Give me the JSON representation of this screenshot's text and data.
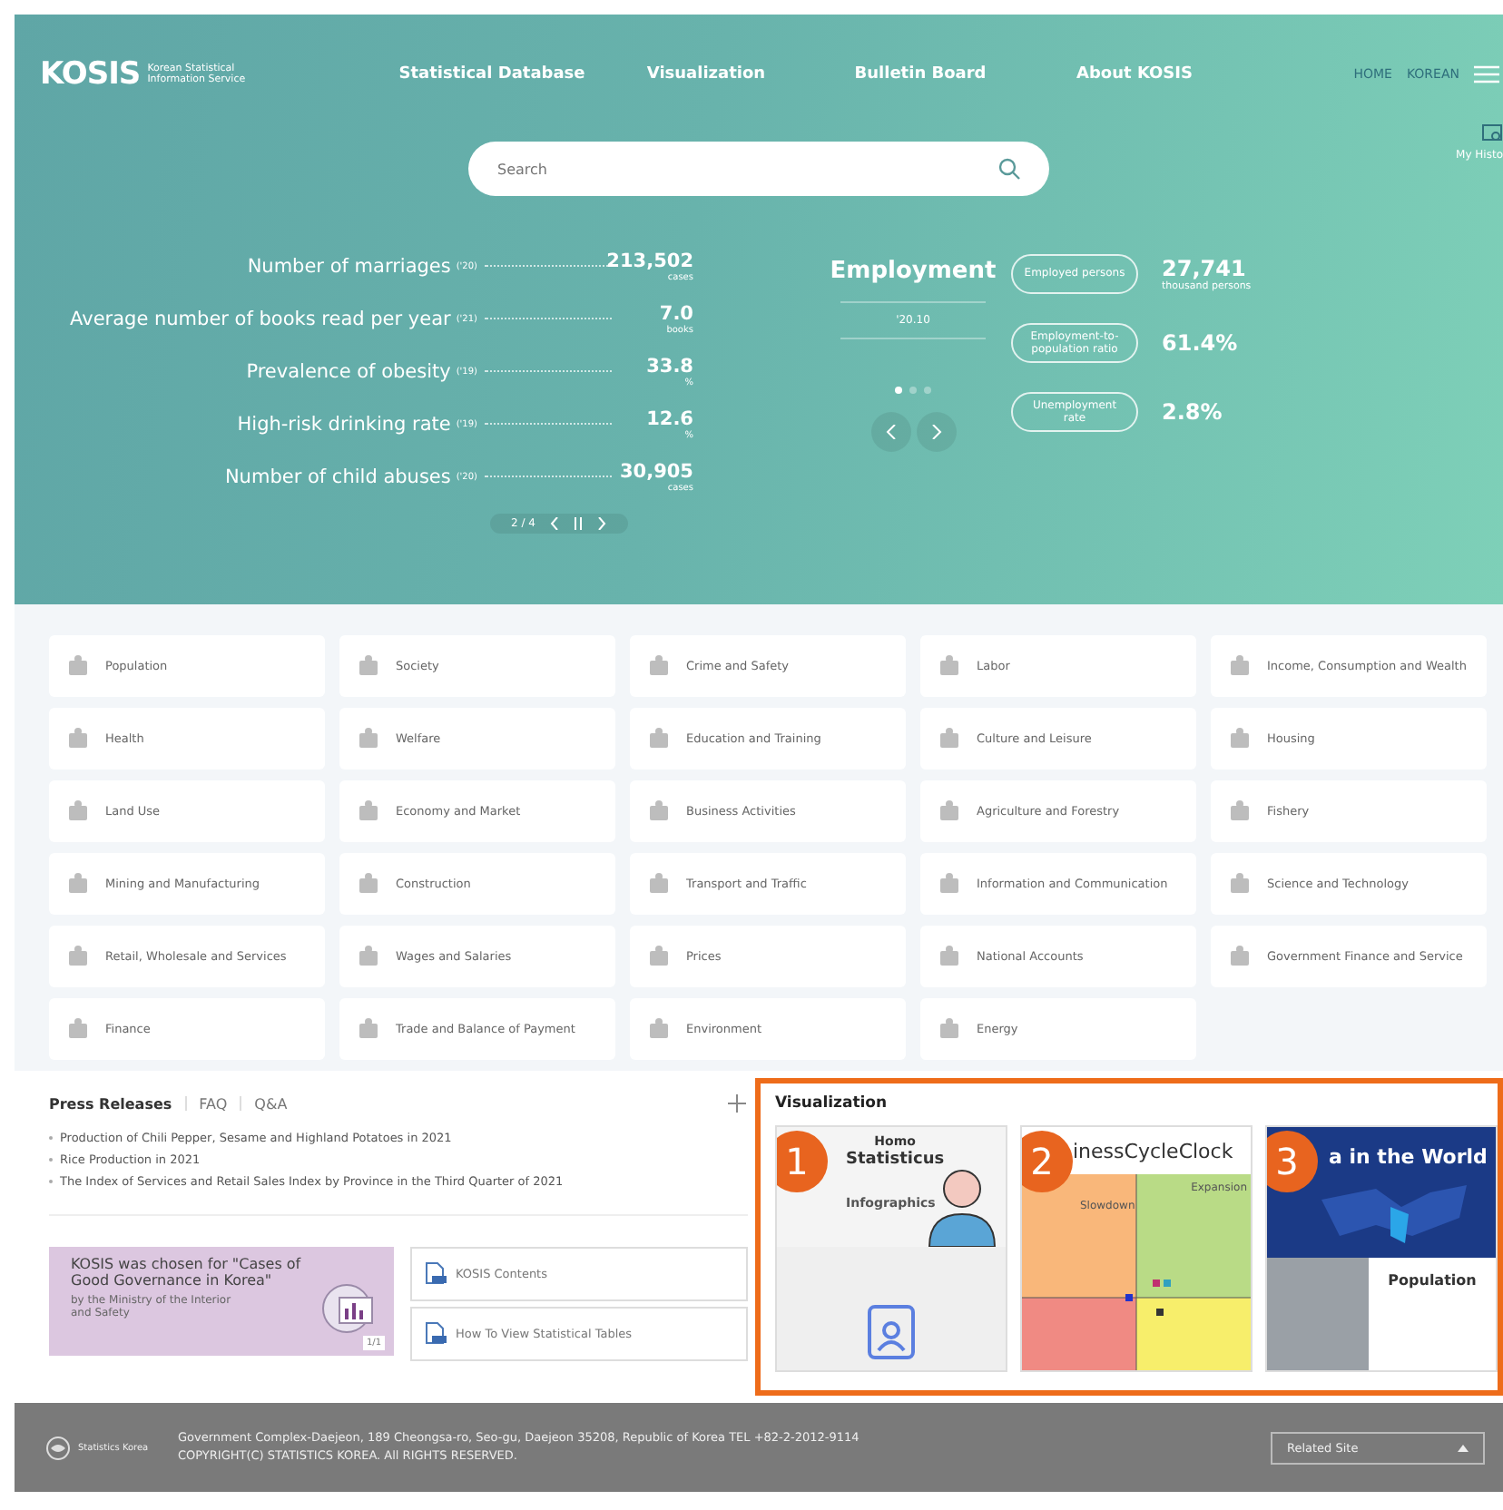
{
  "header": {
    "logo": "KOSIS",
    "logo_subtitle": "Korean Statistical Information Service",
    "nav": [
      "Statistical Database",
      "Visualization",
      "Bulletin Board",
      "About KOSIS"
    ],
    "utility_links": [
      "HOME",
      "KOREAN"
    ],
    "my_history": "My Histo"
  },
  "search": {
    "placeholder": "Search"
  },
  "indicators": [
    {
      "label": "Number of marriages",
      "year": "('20)",
      "value": "213,502",
      "unit": "cases"
    },
    {
      "label": "Average number of books read per year",
      "year": "('21)",
      "value": "7.0",
      "unit": "books"
    },
    {
      "label": "Prevalence of obesity",
      "year": "('19)",
      "value": "33.8",
      "unit": "%"
    },
    {
      "label": "High-risk drinking rate",
      "year": "('19)",
      "value": "12.6",
      "unit": "%"
    },
    {
      "label": "Number of child abuses",
      "year": "('20)",
      "value": "30,905",
      "unit": "cases"
    }
  ],
  "indicator_pager": "2 / 4",
  "employment": {
    "title": "Employment",
    "period": "'20.10",
    "dots": [
      {
        "selected": true
      },
      {
        "selected": false
      },
      {
        "selected": false
      }
    ],
    "rows": [
      {
        "label": "Employed persons",
        "value": "27,741",
        "unit": "thousand persons"
      },
      {
        "label": "Employment-to-population ratio",
        "value": "61.4%"
      },
      {
        "label": "Unemployment rate",
        "value": "2.8%"
      }
    ]
  },
  "categories": [
    "Population",
    "Society",
    "Crime and Safety",
    "Labor",
    "Income, Consumption and Wealth",
    "Health",
    "Welfare",
    "Education and Training",
    "Culture and Leisure",
    "Housing",
    "Land Use",
    "Economy and Market",
    "Business Activities",
    "Agriculture and Forestry",
    "Fishery",
    "Mining and Manufacturing",
    "Construction",
    "Transport and Traffic",
    "Information and Communication",
    "Science and Technology",
    "Retail, Wholesale and Services",
    "Wages and Salaries",
    "Prices",
    "National Accounts",
    "Government Finance and Service",
    "Finance",
    "Trade and Balance of Payment",
    "Environment",
    "Energy"
  ],
  "board": {
    "tabs": [
      {
        "label": "Press Releases",
        "selected": true
      },
      {
        "label": "FAQ",
        "selected": false
      },
      {
        "label": "Q&A",
        "selected": false
      }
    ],
    "items": [
      "Production of Chili Pepper, Sesame and Highland Potatoes in 2021",
      "Rice Production in 2021",
      "The Index of Services and Retail Sales Index by Province in the Third Quarter of 2021"
    ]
  },
  "banner": {
    "title": "KOSIS was chosen for \"Cases of Good Governance in Korea\"",
    "subtitle": "by the Ministry of the Interior and Safety",
    "pager": "1/1"
  },
  "quick_links": [
    "KOSIS Contents",
    "How To View Statistical Tables"
  ],
  "visualization": {
    "title": "Visualization",
    "items": [
      {
        "number": "1",
        "kind": "infographic",
        "captions": [
          "Homo",
          "Statisticus",
          "Infographics"
        ]
      },
      {
        "number": "2",
        "kind": "clock",
        "captions": [
          "inessCycleClock",
          "Slowdown",
          "Expansion"
        ]
      },
      {
        "number": "3",
        "kind": "world",
        "captions": [
          "a in the World",
          "Population"
        ]
      }
    ]
  },
  "footer": {
    "org": "Statistics Korea",
    "address": "Government Complex-Daejeon, 189 Cheongsa-ro, Seo-gu, Daejeon 35208, Republic of Korea TEL +82-2-2012-9114",
    "copyright": "COPYRIGHT(C) STATISTICS KOREA. All RIGHTS RESERVED.",
    "related_site": "Related Site"
  }
}
